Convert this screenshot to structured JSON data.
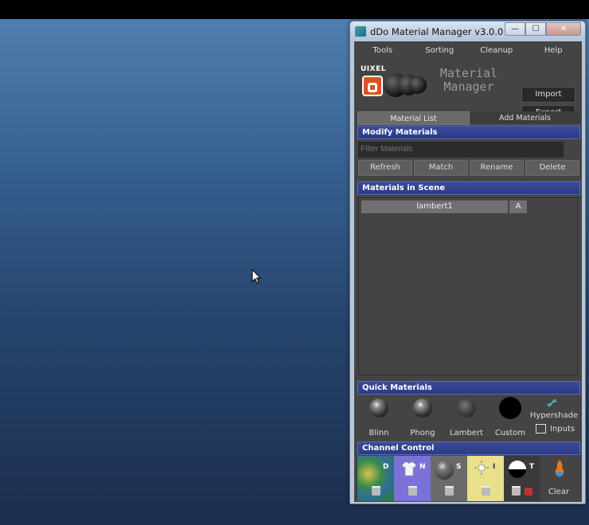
{
  "window": {
    "title": "dDo Material Manager v3.0.0",
    "min_glyph": "—",
    "max_glyph": "☐",
    "close_glyph": "✕"
  },
  "menu": [
    "Tools",
    "Sorting",
    "Cleanup",
    "Help"
  ],
  "logo": {
    "brand": "UIXEL",
    "app_name_line1": "Material",
    "app_name_line2": "Manager"
  },
  "buttons": {
    "import": "Import",
    "export": "Export"
  },
  "tabs": {
    "list": "Material List",
    "add": "Add Materials"
  },
  "modify": {
    "header": "Modify Materials",
    "filter_placeholder": "Filter Materials",
    "actions": [
      "Refresh",
      "Match",
      "Rename",
      "Delete"
    ]
  },
  "scene": {
    "header": "Materials in Scene",
    "materials": [
      {
        "name": "lambert1",
        "flag": "A"
      }
    ]
  },
  "quick": {
    "header": "Quick Materials",
    "items": [
      "Blinn",
      "Phong",
      "Lambert",
      "Custom"
    ],
    "hypershade": "Hypershade",
    "inputs": "Inputs"
  },
  "channel": {
    "header": "Channel Control",
    "channels": [
      "D",
      "N",
      "S",
      "I",
      "T"
    ],
    "clear": "Clear"
  },
  "colors": {
    "section_header": "#2f3e8c",
    "panel": "#444444",
    "viewport_top": "#4f7fae",
    "viewport_bottom": "#1c2e4d"
  }
}
